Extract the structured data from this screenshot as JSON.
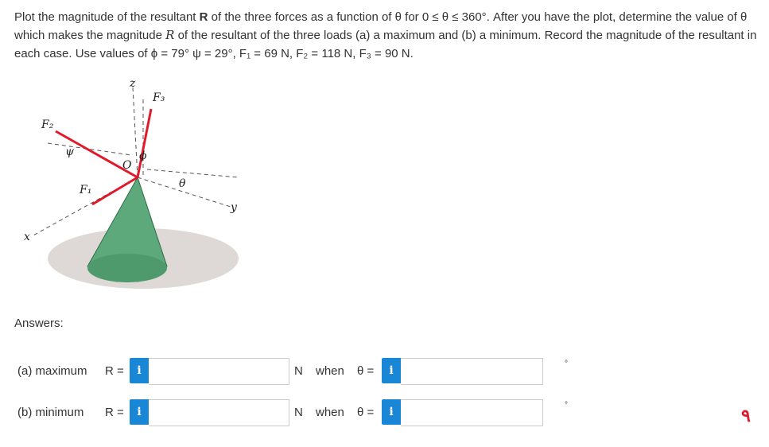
{
  "problem": {
    "text_before": "Plot the magnitude of the resultant ",
    "R_bold": "R",
    "text_mid": " of the three forces as a function of θ for 0 ≤ θ ≤ 360°. After you have the plot, determine the value of θ which makes the magnitude ",
    "R_italic": "R",
    "text_after": " of the resultant of the three loads (a) a maximum and (b) a minimum. Record the magnitude of the resultant in each case. Use values of ",
    "values": "ϕ = 79° ψ = 29°, F₁ = 69 N, F₂ = 118 N, F₃ = 90 N."
  },
  "figure": {
    "labels": {
      "z": "z",
      "F3": "F₃",
      "F2": "F₂",
      "F1": "F₁",
      "O": "O",
      "x": "x",
      "y": "y",
      "psi": "ψ",
      "phi": "ϕ",
      "theta": "θ"
    }
  },
  "answers": {
    "heading": "Answers:",
    "rows": [
      {
        "label": "(a) maximum",
        "r_label": "R =",
        "icon": "i",
        "r_value": "",
        "unit": "N",
        "when": "when",
        "theta_label": "θ =",
        "theta_value": "",
        "theta_unit": "°"
      },
      {
        "label": "(b) minimum",
        "r_label": "R =",
        "icon": "i",
        "r_value": "",
        "unit": "N",
        "when": "when",
        "theta_label": "θ =",
        "theta_value": "",
        "theta_unit": "°"
      }
    ]
  },
  "mark": "٩"
}
